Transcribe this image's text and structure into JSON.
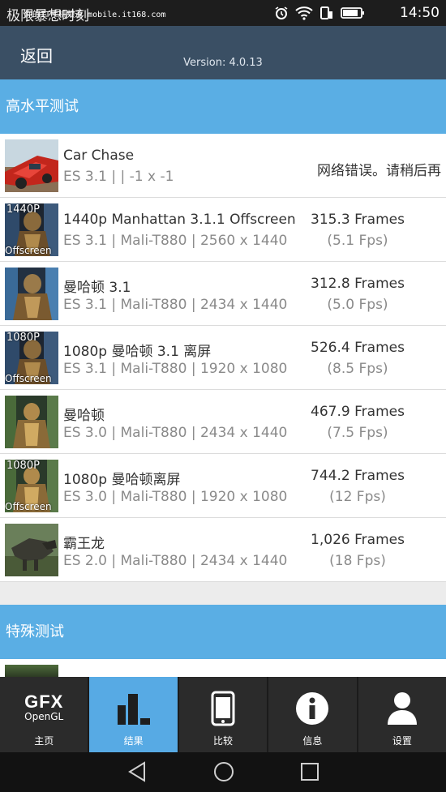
{
  "statusbar": {
    "title": "极限暴想时刻",
    "watermark": "你的IT手机频道 mobile.it168.com",
    "time": "14:50"
  },
  "header": {
    "back_label": "返回",
    "version": "Version: 4.0.13"
  },
  "sections": {
    "high_level": "高水平测试",
    "special": "特殊测试"
  },
  "tests": [
    {
      "name": "Car Chase",
      "sub": "ES 3.1 |  | -1 x -1",
      "error": "网络错误。请稍后再",
      "thumb_top": "",
      "thumb_bottom": "",
      "icon": "car-chase-thumbnail"
    },
    {
      "name": "1440p Manhattan 3.1.1 Offscreen",
      "sub": "ES 3.1 | Mali-T880 | 2560 x 1440",
      "score": "315.3 Frames",
      "fps": "(5.1 Fps)",
      "thumb_top": "1440P",
      "thumb_bottom": "Offscreen",
      "icon": "manhattan-thumbnail"
    },
    {
      "name": "曼哈顿 3.1",
      "sub": "ES 3.1 | Mali-T880 | 2434 x 1440",
      "score": "312.8 Frames",
      "fps": "(5.0 Fps)",
      "thumb_top": "",
      "thumb_bottom": "",
      "icon": "manhattan-thumbnail"
    },
    {
      "name": "1080p 曼哈顿 3.1 离屏",
      "sub": "ES 3.1 | Mali-T880 | 1920 x 1080",
      "score": "526.4 Frames",
      "fps": "(8.5 Fps)",
      "thumb_top": "1080P",
      "thumb_bottom": "Offscreen",
      "icon": "manhattan-thumbnail"
    },
    {
      "name": "曼哈顿",
      "sub": "ES 3.0 | Mali-T880 | 2434 x 1440",
      "score": "467.9 Frames",
      "fps": "(7.5 Fps)",
      "thumb_top": "",
      "thumb_bottom": "",
      "icon": "manhattan-thumbnail"
    },
    {
      "name": "1080p 曼哈顿离屏",
      "sub": "ES 3.0 | Mali-T880 | 1920 x 1080",
      "score": "744.2 Frames",
      "fps": "(12 Fps)",
      "thumb_top": "1080P",
      "thumb_bottom": "Offscreen",
      "icon": "manhattan-thumbnail"
    },
    {
      "name": "霸王龙",
      "sub": "ES 2.0 | Mali-T880 | 2434 x 1440",
      "score": "1,026 Frames",
      "fps": "(18 Fps)",
      "thumb_top": "",
      "thumb_bottom": "",
      "icon": "t-rex-thumbnail"
    }
  ],
  "tabs": [
    {
      "label": "主页",
      "logo_main": "GFX",
      "logo_sub": "OpenGL",
      "icon": "gfx-logo-icon",
      "active": false
    },
    {
      "label": "结果",
      "icon": "bar-chart-icon",
      "active": true
    },
    {
      "label": "比较",
      "icon": "phone-icon",
      "active": false
    },
    {
      "label": "信息",
      "icon": "info-icon",
      "active": false
    },
    {
      "label": "设置",
      "icon": "user-icon",
      "active": false
    }
  ],
  "colors": {
    "header_bg": "#3a4f64",
    "section_bg": "#5aaee4",
    "tab_active": "#57aae4",
    "tabbar_bg": "#2b2b2b"
  }
}
